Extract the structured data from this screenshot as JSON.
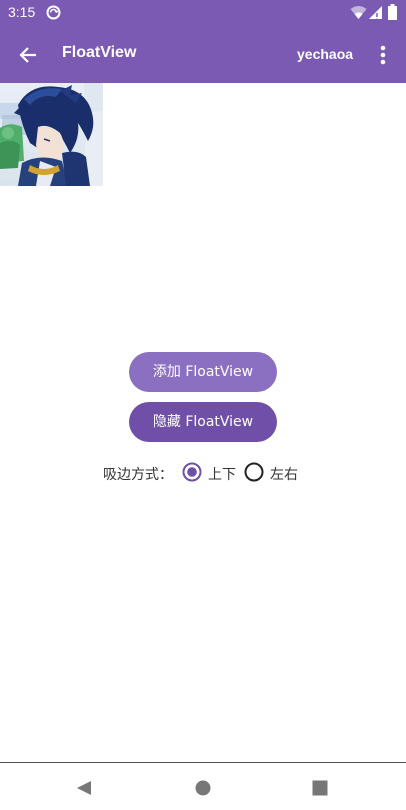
{
  "status_bar": {
    "time": "3:15"
  },
  "app_bar": {
    "title": "FloatView",
    "action": "yechaoa"
  },
  "buttons": {
    "add": "添加 FloatView",
    "hide": "隐藏 FloatView"
  },
  "radio": {
    "label": "吸边方式：",
    "options": [
      {
        "label": "上下",
        "selected": true
      },
      {
        "label": "左右",
        "selected": false
      }
    ]
  },
  "colors": {
    "primary": "#7b5ab3",
    "button_add": "#8b6fc0",
    "button_hide": "#6f4fa8"
  },
  "icons": {
    "back": "arrow-back-icon",
    "overflow": "more-vert-icon",
    "float_image": "anime-avatar-image"
  }
}
